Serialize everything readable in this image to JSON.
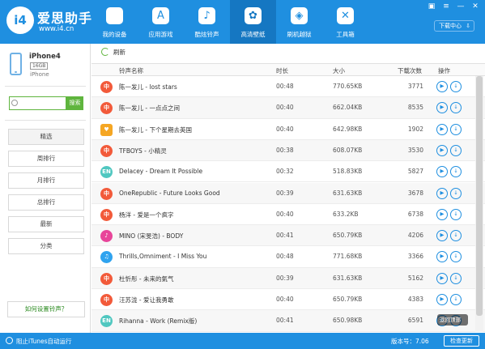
{
  "brand": {
    "logo_text": "i4",
    "name": "爱思助手",
    "url": "www.i4.cn"
  },
  "nav": [
    {
      "label": "我的设备",
      "icon": "apple-icon",
      "glyph": ""
    },
    {
      "label": "应用游戏",
      "icon": "app-store-icon",
      "glyph": "A"
    },
    {
      "label": "酷炫铃声",
      "icon": "bell-icon",
      "glyph": "♪"
    },
    {
      "label": "高清壁纸",
      "icon": "flower-icon",
      "glyph": "✿"
    },
    {
      "label": "刷机越狱",
      "icon": "dropbox-icon",
      "glyph": "◈"
    },
    {
      "label": "工具箱",
      "icon": "tools-icon",
      "glyph": "✕"
    }
  ],
  "active_nav": 3,
  "window_controls": {
    "skin": "▣",
    "menu": "≡",
    "minimize": "—",
    "close": "✕"
  },
  "download_center": {
    "label": "下载中心",
    "icon": "download-icon",
    "glyph": "⇩"
  },
  "device": {
    "name": "iPhone4",
    "capacity": "16GB",
    "model": "iPhone"
  },
  "search": {
    "placeholder": "",
    "button": "搜索"
  },
  "menu": [
    "精选",
    "周排行",
    "月排行",
    "总排行",
    "最新",
    "分类"
  ],
  "help_link": "如何设置铃声？",
  "toolbar": {
    "refresh": "刷新"
  },
  "table": {
    "headers": {
      "name": "铃声名称",
      "duration": "时长",
      "size": "大小",
      "downloads": "下载次数",
      "ops": "操作"
    },
    "rows": [
      {
        "icon": "red",
        "glyph": "中",
        "name": "陈一发儿 - lost stars",
        "duration": "00:48",
        "size": "770.65KB",
        "downloads": "3771"
      },
      {
        "icon": "red",
        "glyph": "中",
        "name": "陈一发儿 - 一点点之间",
        "duration": "00:40",
        "size": "662.04KB",
        "downloads": "8535"
      },
      {
        "icon": "orange",
        "glyph": "♥",
        "name": "陈一发儿 - 下个星期去英国",
        "duration": "00:40",
        "size": "642.98KB",
        "downloads": "1902"
      },
      {
        "icon": "red",
        "glyph": "中",
        "name": "TFBOYS - 小精灵",
        "duration": "00:38",
        "size": "608.07KB",
        "downloads": "3530"
      },
      {
        "icon": "teal",
        "glyph": "EN",
        "name": "Delacey - Dream It Possible",
        "duration": "00:32",
        "size": "518.83KB",
        "downloads": "5827"
      },
      {
        "icon": "red",
        "glyph": "中",
        "name": "OneRepublic - Future Looks Good",
        "duration": "00:39",
        "size": "631.63KB",
        "downloads": "3678"
      },
      {
        "icon": "red",
        "glyph": "中",
        "name": "杨洋 - 爱是一个疯字",
        "duration": "00:40",
        "size": "633.2KB",
        "downloads": "6738"
      },
      {
        "icon": "pink",
        "glyph": "♪",
        "name": "MINO (宋旻浩) - BODY",
        "duration": "00:41",
        "size": "650.79KB",
        "downloads": "4206"
      },
      {
        "icon": "blue",
        "glyph": "♫",
        "name": "Thrills,Omniment - I Miss You",
        "duration": "00:48",
        "size": "771.68KB",
        "downloads": "3366"
      },
      {
        "icon": "red",
        "glyph": "中",
        "name": "杜忻彤 - 未来的氣气",
        "duration": "00:39",
        "size": "631.63KB",
        "downloads": "5162"
      },
      {
        "icon": "red",
        "glyph": "中",
        "name": "汪苏泷 - 爱让我勇敢",
        "duration": "00:40",
        "size": "650.79KB",
        "downloads": "4383"
      },
      {
        "icon": "teal",
        "glyph": "EN",
        "name": "Rihanna - Work (Remix版)",
        "duration": "00:41",
        "size": "650.98KB",
        "downloads": "6591"
      }
    ],
    "op_play": "▶",
    "op_download": "↓"
  },
  "back_to_top": "返回顶部",
  "status": {
    "itunes": "阻止iTunes自动运行",
    "version": "版本号：7.06",
    "update": "检查更新"
  },
  "colors": {
    "primary": "#1f8fe0",
    "green": "#5fb53e",
    "red_icon": "#f25a3a"
  }
}
